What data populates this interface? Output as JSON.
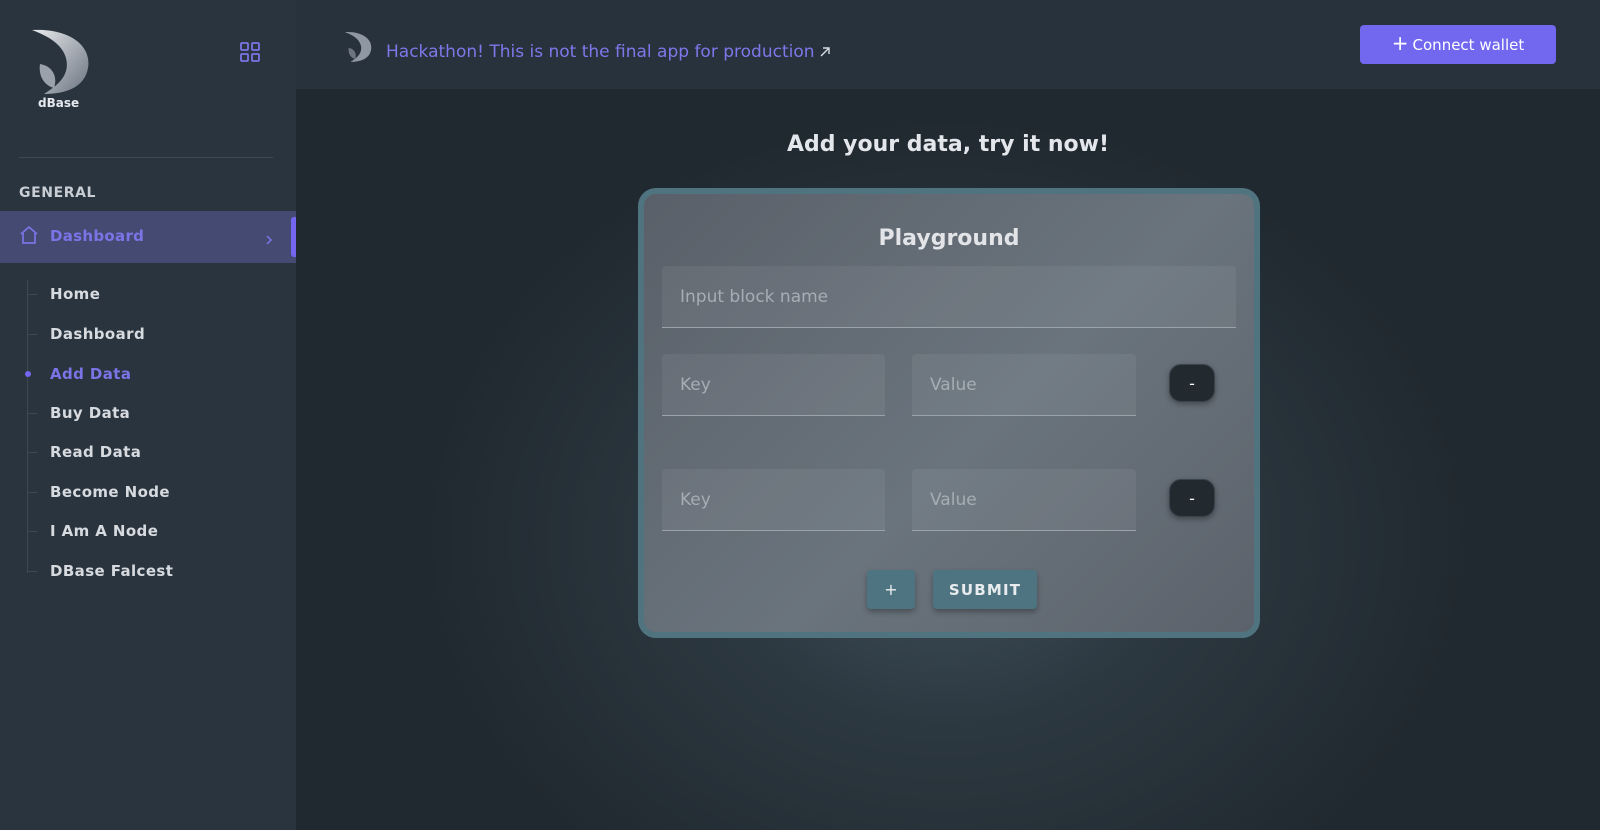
{
  "brand": {
    "name": "dBase"
  },
  "sidebar": {
    "section": "GENERAL",
    "active": {
      "label": "Dashboard"
    },
    "items": [
      {
        "label": "Home"
      },
      {
        "label": "Dashboard"
      },
      {
        "label": "Add Data"
      },
      {
        "label": "Buy Data"
      },
      {
        "label": "Read Data"
      },
      {
        "label": "Become Node"
      },
      {
        "label": "I Am A Node"
      },
      {
        "label": "DBase Falcest"
      }
    ],
    "selected_index": 2
  },
  "topbar": {
    "banner": "Hackathon! This is not the final app for production",
    "banner_icon": "external-link-arrow",
    "connect_label": "Connect wallet"
  },
  "main": {
    "title": "Add your data, try it now!",
    "card": {
      "title": "Playground",
      "block_placeholder": "Input block name",
      "rows": [
        {
          "key_placeholder": "Key",
          "value_placeholder": "Value",
          "remove_label": "-"
        },
        {
          "key_placeholder": "Key",
          "value_placeholder": "Value",
          "remove_label": "-"
        }
      ],
      "add_label": "+",
      "submit_label": "SUBMIT"
    }
  },
  "colors": {
    "accent": "#7268f0",
    "sidebar_bg": "#2a343e",
    "card_border": "#4f7480"
  }
}
